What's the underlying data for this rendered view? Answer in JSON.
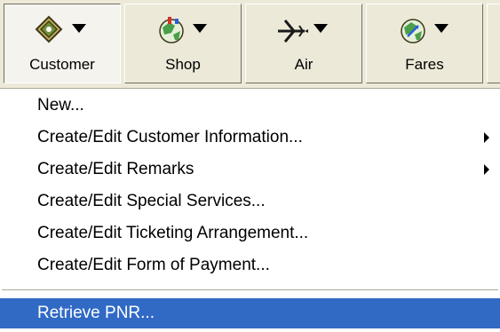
{
  "toolbar": {
    "buttons": [
      {
        "label": "Customer",
        "icon": "customer-tag-icon",
        "pressed": true
      },
      {
        "label": "Shop",
        "icon": "shop-globe-icon",
        "pressed": false
      },
      {
        "label": "Air",
        "icon": "airplane-icon",
        "pressed": false
      },
      {
        "label": "Fares",
        "icon": "fares-globe-icon",
        "pressed": false
      }
    ]
  },
  "menu": {
    "items": [
      {
        "label": "New..."
      },
      {
        "label": "Create/Edit Customer Information...",
        "submenu": true
      },
      {
        "label": "Create/Edit Remarks",
        "submenu": true
      },
      {
        "label": "Create/Edit Special Services..."
      },
      {
        "label": "Create/Edit Ticketing Arrangement..."
      },
      {
        "label": "Create/Edit Form of Payment..."
      },
      {
        "label": "Retrieve PNR...",
        "selected": true
      }
    ]
  },
  "colors": {
    "toolbar_bg": "#ece9d8",
    "selection": "#316ac5"
  }
}
